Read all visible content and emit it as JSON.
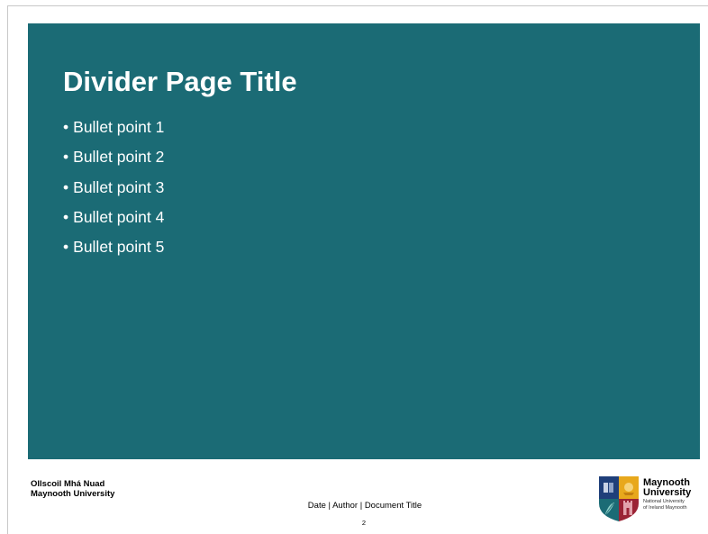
{
  "slide": {
    "title": "Divider Page Title",
    "bullet_symbol": "•",
    "bullets": [
      "Bullet point 1",
      "Bullet point 2",
      "Bullet point 3",
      "Bullet point 4",
      "Bullet point 5"
    ]
  },
  "branding": {
    "irish_name": "Ollscoil Mhá Nuad",
    "english_name": "Maynooth University"
  },
  "footer": {
    "text": "Date | Author | Document Title",
    "page_number": "2"
  },
  "logo": {
    "name_line_1": "Maynooth",
    "name_line_2": "University",
    "sub_line_1": "National University",
    "sub_line_2": "of Ireland Maynooth",
    "crest_icon": "university-crest-icon"
  },
  "colors": {
    "panel_background": "#1b6b75",
    "slide_text": "#ffffff",
    "crest_blue": "#1f3f7a",
    "crest_gold": "#e8a81c",
    "crest_red": "#9b2335",
    "crest_teal": "#1b6b75"
  }
}
